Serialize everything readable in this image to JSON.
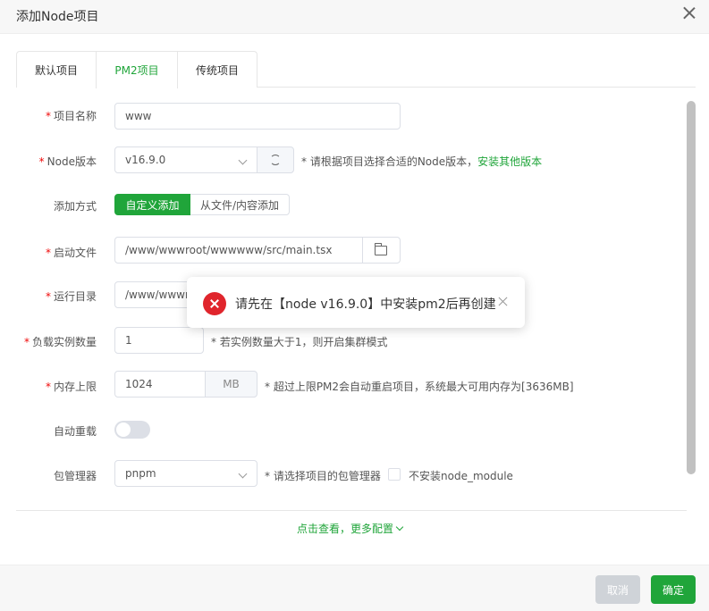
{
  "dialog": {
    "title": "添加Node项目"
  },
  "tabs": [
    "默认项目",
    "PM2项目",
    "传统项目"
  ],
  "form": {
    "project_name": {
      "label": "项目名称",
      "value": "www"
    },
    "node_version": {
      "label": "Node版本",
      "value": "v16.9.0",
      "hint": "* 请根据项目选择合适的Node版本，",
      "link": "安装其他版本"
    },
    "add_method": {
      "label": "添加方式",
      "options": [
        "自定义添加",
        "从文件/内容添加"
      ]
    },
    "start_file": {
      "label": "启动文件",
      "value": "/www/wwwroot/wwwwww/src/main.tsx"
    },
    "run_dir": {
      "label": "运行目录",
      "value": "/www/wwwr"
    },
    "instances": {
      "label": "负载实例数量",
      "value": "1",
      "hint": "* 若实例数量大于1，则开启集群模式"
    },
    "memory": {
      "label": "内存上限",
      "value": "1024",
      "unit": "MB",
      "hint": "* 超过上限PM2会自动重启项目，系统最大可用内存为[3636MB]"
    },
    "auto_reload": {
      "label": "自动重载",
      "enabled": false
    },
    "package_manager": {
      "label": "包管理器",
      "value": "pnpm",
      "hint": "* 请选择项目的包管理器",
      "checkbox_label": "不安装node_module"
    }
  },
  "more_config": "点击查看，更多配置",
  "toast": {
    "message": "请先在【node v16.9.0】中安装pm2后再创建"
  },
  "footer": {
    "cancel": "取消",
    "confirm": "确定"
  },
  "colors": {
    "accent": "#20a53a",
    "error": "#e0252c",
    "required": "#ef0808"
  }
}
